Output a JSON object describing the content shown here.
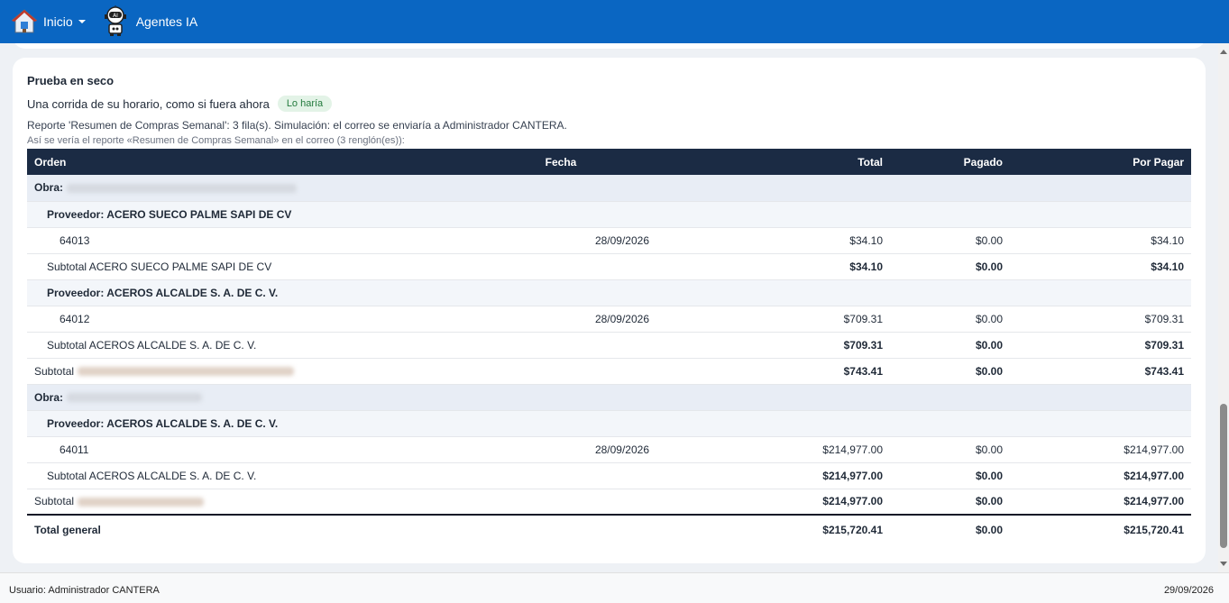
{
  "nav": {
    "home_label": "Inicio",
    "agents_label": "Agentes IA"
  },
  "card": {
    "title": "Prueba en seco",
    "subtitle": "Una corrida de su horario, como si fuera ahora",
    "badge": "Lo haría",
    "info": "Reporte 'Resumen de Compras Semanal': 3 fila(s). Simulación: el correo se enviaría a Administrador CANTERA.",
    "preview": "Así se vería el reporte «Resumen de Compras Semanal» en el correo (3 renglón(es)):"
  },
  "table": {
    "headers": {
      "orden": "Orden",
      "fecha": "Fecha",
      "total": "Total",
      "pagado": "Pagado",
      "por_pagar": "Por Pagar"
    },
    "obra_label": "Obra:",
    "subtotal_label": "Subtotal",
    "rows": {
      "prov1": "Proveedor: ACERO SUECO PALME SAPI DE CV",
      "d1": {
        "orden": "64013",
        "fecha": "28/09/2026",
        "total": "$34.10",
        "pagado": "$0.00",
        "por_pagar": "$34.10"
      },
      "sp1": {
        "label": "Subtotal ACERO SUECO PALME SAPI DE CV",
        "total": "$34.10",
        "pagado": "$0.00",
        "por_pagar": "$34.10"
      },
      "prov2": "Proveedor: ACEROS ALCALDE S. A. DE C. V.",
      "d2": {
        "orden": "64012",
        "fecha": "28/09/2026",
        "total": "$709.31",
        "pagado": "$0.00",
        "por_pagar": "$709.31"
      },
      "sp2": {
        "label": "Subtotal ACEROS ALCALDE S. A. DE C. V.",
        "total": "$709.31",
        "pagado": "$0.00",
        "por_pagar": "$709.31"
      },
      "so1": {
        "total": "$743.41",
        "pagado": "$0.00",
        "por_pagar": "$743.41"
      },
      "prov3": "Proveedor: ACEROS ALCALDE S. A. DE C. V.",
      "d3": {
        "orden": "64011",
        "fecha": "28/09/2026",
        "total": "$214,977.00",
        "pagado": "$0.00",
        "por_pagar": "$214,977.00"
      },
      "sp3": {
        "label": "Subtotal ACEROS ALCALDE S. A. DE C. V.",
        "total": "$214,977.00",
        "pagado": "$0.00",
        "por_pagar": "$214,977.00"
      },
      "so2": {
        "total": "$214,977.00",
        "pagado": "$0.00",
        "por_pagar": "$214,977.00"
      },
      "grand": {
        "label": "Total general",
        "total": "$215,720.41",
        "pagado": "$0.00",
        "por_pagar": "$215,720.41"
      }
    }
  },
  "footer": {
    "user": "Usuario: Administrador CANTERA",
    "date": "29/09/2026"
  }
}
